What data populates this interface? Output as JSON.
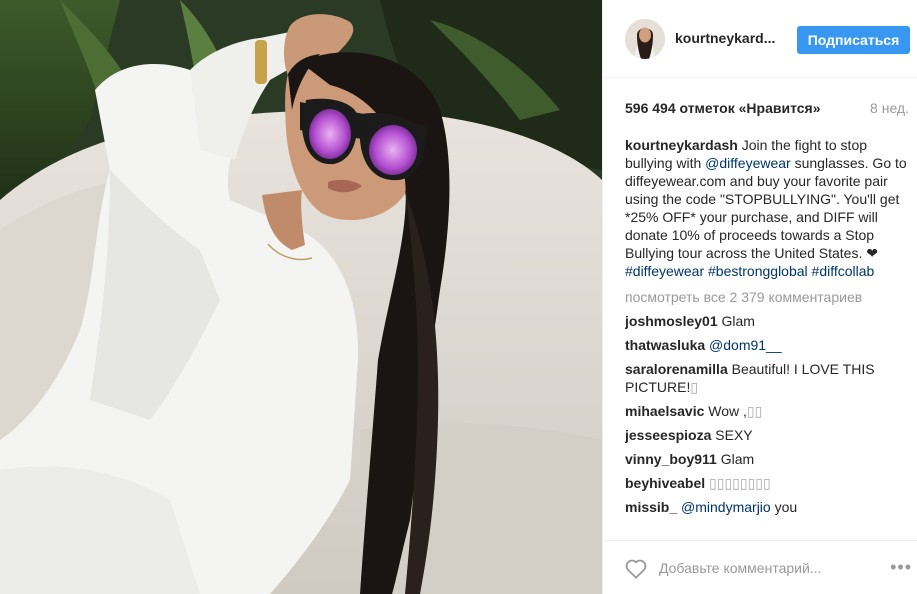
{
  "post": {
    "username": "kourtneykard...",
    "follow_label": "Подписаться",
    "likes": "596 494 отметок «Нравится»",
    "age": "8 нед.",
    "caption": {
      "user": "kourtneykardash",
      "text1": "Join the fight to stop bullying with",
      "mention": "@diffeyewear",
      "text2": "sunglasses. Go to diffeyewear.com and buy your favorite pair using the code \"STOPBULLYING\". You'll get *25% OFF* your purchase, and DIFF will donate 10% of proceeds towards a Stop Bullying tour across the United States. ❤",
      "hashtags": "#diffeyewear #bestrongglobal #diffcollab"
    },
    "view_all": "посмотреть все 2 379 комментариев",
    "comments": [
      {
        "user": "joshmosley01",
        "text": "Glam",
        "tag": ""
      },
      {
        "user": "thatwasluka",
        "text": "",
        "tag": "@dom91__"
      },
      {
        "user": "saralorenamilla",
        "text": "Beautiful! I LOVE THIS PICTURE!",
        "tag": "",
        "glyph": "▯"
      },
      {
        "user": "mihaelsavic",
        "text": "Wow ,",
        "tag": "",
        "glyph": "▯▯"
      },
      {
        "user": "jesseespioza",
        "text": "SEXY",
        "tag": ""
      },
      {
        "user": "vinny_boy911",
        "text": "Glam",
        "tag": ""
      },
      {
        "user": "beyhiveabel",
        "text": "",
        "tag": "",
        "glyph": "▯▯▯▯▯▯▯▯"
      },
      {
        "user": "missib_",
        "text": "you",
        "tag": "@mindymarjio"
      }
    ],
    "add_comment_placeholder": "Добавьте комментарий...",
    "more_glyph": "•••"
  },
  "colors": {
    "accent": "#3897f0",
    "link": "#003569",
    "text": "#262626",
    "muted": "#999999"
  },
  "icons": {
    "heart": "heart-icon",
    "more": "more-options-icon"
  }
}
